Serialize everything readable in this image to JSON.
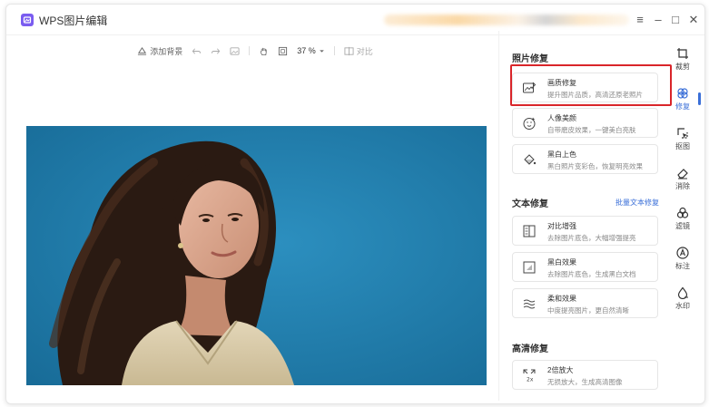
{
  "titlebar": {
    "title": "WPS图片编辑",
    "controls": [
      "≡",
      "–",
      "□",
      "✕"
    ]
  },
  "toolbar": {
    "add_background": "添加背景",
    "zoom": "37 %",
    "compare": "对比"
  },
  "panel": {
    "photo_repair": {
      "title": "照片修复",
      "items": [
        {
          "title": "画质修复",
          "desc": "提升图片品质，高清还原老照片",
          "icon": "image-repair-icon"
        },
        {
          "title": "人像美颜",
          "desc": "自带磨皮效果，一键美白亮肤",
          "icon": "face-beauty-icon"
        },
        {
          "title": "黑白上色",
          "desc": "黑白照片变彩色，恢复明亮效果",
          "icon": "colorize-icon"
        }
      ]
    },
    "text_repair": {
      "title": "文本修复",
      "link": "批量文本修复",
      "items": [
        {
          "title": "对比增强",
          "desc": "去除图片底色，大幅增强提亮",
          "icon": "contrast-icon"
        },
        {
          "title": "黑白效果",
          "desc": "去除图片底色，生成黑白文档",
          "icon": "bw-effect-icon"
        },
        {
          "title": "柔和效果",
          "desc": "中度提亮图片，更自然清晰",
          "icon": "soft-effect-icon"
        }
      ]
    },
    "hd_repair": {
      "title": "高清修复",
      "items": [
        {
          "title": "2倍放大",
          "desc": "无损放大，生成高清图像",
          "icon": "upscale-icon"
        }
      ]
    }
  },
  "rail": {
    "items": [
      {
        "label": "裁剪",
        "icon": "crop-icon"
      },
      {
        "label": "修复",
        "icon": "repair-icon",
        "active": true
      },
      {
        "label": "抠图",
        "icon": "cutout-icon"
      },
      {
        "label": "消除",
        "icon": "eraser-icon"
      },
      {
        "label": "滤镜",
        "icon": "filter-icon"
      },
      {
        "label": "标注",
        "icon": "annotate-icon"
      },
      {
        "label": "水印",
        "icon": "watermark-icon"
      }
    ]
  },
  "colors": {
    "accent": "#3a6fd8",
    "highlight": "#d9252a",
    "photo_bg": "#1f7aa8",
    "logo": "#7a5cf0"
  }
}
